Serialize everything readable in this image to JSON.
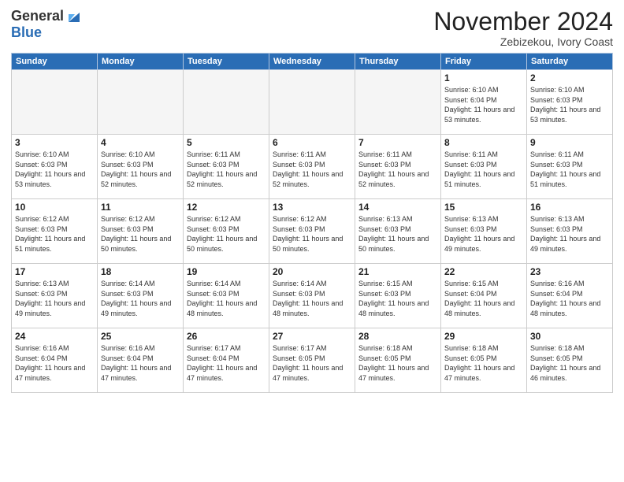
{
  "header": {
    "logo_line1": "General",
    "logo_line2": "Blue",
    "title": "November 2024",
    "subtitle": "Zebizekou, Ivory Coast"
  },
  "calendar": {
    "days_of_week": [
      "Sunday",
      "Monday",
      "Tuesday",
      "Wednesday",
      "Thursday",
      "Friday",
      "Saturday"
    ],
    "weeks": [
      [
        {
          "day": "",
          "empty": true
        },
        {
          "day": "",
          "empty": true
        },
        {
          "day": "",
          "empty": true
        },
        {
          "day": "",
          "empty": true
        },
        {
          "day": "",
          "empty": true
        },
        {
          "day": "1",
          "sunrise": "6:10 AM",
          "sunset": "6:04 PM",
          "daylight": "11 hours and 53 minutes."
        },
        {
          "day": "2",
          "sunrise": "6:10 AM",
          "sunset": "6:03 PM",
          "daylight": "11 hours and 53 minutes."
        }
      ],
      [
        {
          "day": "3",
          "sunrise": "6:10 AM",
          "sunset": "6:03 PM",
          "daylight": "11 hours and 53 minutes."
        },
        {
          "day": "4",
          "sunrise": "6:10 AM",
          "sunset": "6:03 PM",
          "daylight": "11 hours and 52 minutes."
        },
        {
          "day": "5",
          "sunrise": "6:11 AM",
          "sunset": "6:03 PM",
          "daylight": "11 hours and 52 minutes."
        },
        {
          "day": "6",
          "sunrise": "6:11 AM",
          "sunset": "6:03 PM",
          "daylight": "11 hours and 52 minutes."
        },
        {
          "day": "7",
          "sunrise": "6:11 AM",
          "sunset": "6:03 PM",
          "daylight": "11 hours and 52 minutes."
        },
        {
          "day": "8",
          "sunrise": "6:11 AM",
          "sunset": "6:03 PM",
          "daylight": "11 hours and 51 minutes."
        },
        {
          "day": "9",
          "sunrise": "6:11 AM",
          "sunset": "6:03 PM",
          "daylight": "11 hours and 51 minutes."
        }
      ],
      [
        {
          "day": "10",
          "sunrise": "6:12 AM",
          "sunset": "6:03 PM",
          "daylight": "11 hours and 51 minutes."
        },
        {
          "day": "11",
          "sunrise": "6:12 AM",
          "sunset": "6:03 PM",
          "daylight": "11 hours and 50 minutes."
        },
        {
          "day": "12",
          "sunrise": "6:12 AM",
          "sunset": "6:03 PM",
          "daylight": "11 hours and 50 minutes."
        },
        {
          "day": "13",
          "sunrise": "6:12 AM",
          "sunset": "6:03 PM",
          "daylight": "11 hours and 50 minutes."
        },
        {
          "day": "14",
          "sunrise": "6:13 AM",
          "sunset": "6:03 PM",
          "daylight": "11 hours and 50 minutes."
        },
        {
          "day": "15",
          "sunrise": "6:13 AM",
          "sunset": "6:03 PM",
          "daylight": "11 hours and 49 minutes."
        },
        {
          "day": "16",
          "sunrise": "6:13 AM",
          "sunset": "6:03 PM",
          "daylight": "11 hours and 49 minutes."
        }
      ],
      [
        {
          "day": "17",
          "sunrise": "6:13 AM",
          "sunset": "6:03 PM",
          "daylight": "11 hours and 49 minutes."
        },
        {
          "day": "18",
          "sunrise": "6:14 AM",
          "sunset": "6:03 PM",
          "daylight": "11 hours and 49 minutes."
        },
        {
          "day": "19",
          "sunrise": "6:14 AM",
          "sunset": "6:03 PM",
          "daylight": "11 hours and 48 minutes."
        },
        {
          "day": "20",
          "sunrise": "6:14 AM",
          "sunset": "6:03 PM",
          "daylight": "11 hours and 48 minutes."
        },
        {
          "day": "21",
          "sunrise": "6:15 AM",
          "sunset": "6:03 PM",
          "daylight": "11 hours and 48 minutes."
        },
        {
          "day": "22",
          "sunrise": "6:15 AM",
          "sunset": "6:04 PM",
          "daylight": "11 hours and 48 minutes."
        },
        {
          "day": "23",
          "sunrise": "6:16 AM",
          "sunset": "6:04 PM",
          "daylight": "11 hours and 48 minutes."
        }
      ],
      [
        {
          "day": "24",
          "sunrise": "6:16 AM",
          "sunset": "6:04 PM",
          "daylight": "11 hours and 47 minutes."
        },
        {
          "day": "25",
          "sunrise": "6:16 AM",
          "sunset": "6:04 PM",
          "daylight": "11 hours and 47 minutes."
        },
        {
          "day": "26",
          "sunrise": "6:17 AM",
          "sunset": "6:04 PM",
          "daylight": "11 hours and 47 minutes."
        },
        {
          "day": "27",
          "sunrise": "6:17 AM",
          "sunset": "6:05 PM",
          "daylight": "11 hours and 47 minutes."
        },
        {
          "day": "28",
          "sunrise": "6:18 AM",
          "sunset": "6:05 PM",
          "daylight": "11 hours and 47 minutes."
        },
        {
          "day": "29",
          "sunrise": "6:18 AM",
          "sunset": "6:05 PM",
          "daylight": "11 hours and 47 minutes."
        },
        {
          "day": "30",
          "sunrise": "6:18 AM",
          "sunset": "6:05 PM",
          "daylight": "11 hours and 46 minutes."
        }
      ]
    ]
  }
}
